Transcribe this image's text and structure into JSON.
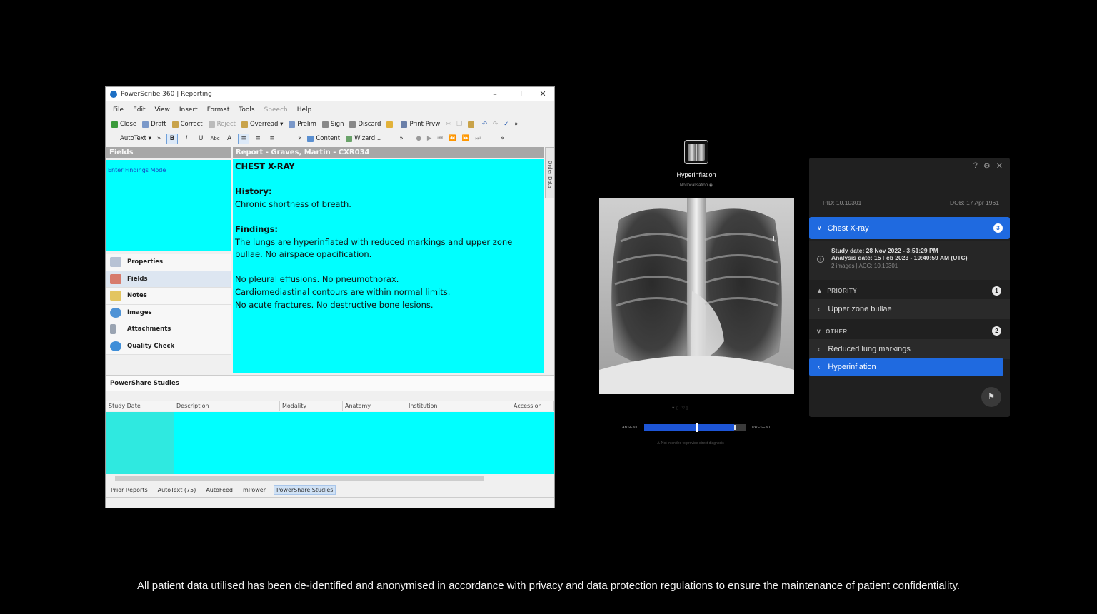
{
  "powerscribe": {
    "window_title": "PowerScribe 360 | Reporting",
    "menu": [
      {
        "label": "File"
      },
      {
        "label": "Edit"
      },
      {
        "label": "View"
      },
      {
        "label": "Insert"
      },
      {
        "label": "Format"
      },
      {
        "label": "Tools"
      },
      {
        "label": "Speech"
      },
      {
        "label": "Help"
      }
    ],
    "toolbar1": {
      "close": "Close",
      "draft": "Draft",
      "correct": "Correct",
      "reject": "Reject",
      "overread": "Overread",
      "prelim": "Prelim",
      "sign": "Sign",
      "discard": "Discard",
      "print_preview": "Print Prvw"
    },
    "toolbar2": {
      "autotext": "AutoText",
      "bold": "B",
      "italic": "I",
      "underline": "U",
      "content": "Content",
      "wizard": "Wizard..."
    },
    "fields_header": "Fields",
    "enter_findings_mode": "Enter Findings Mode",
    "report_header": "Report - Graves, Martin - CXR034",
    "side_tab": "Order Data",
    "report": {
      "title": "CHEST X-RAY",
      "history_label": "History:",
      "history_text": "Chronic shortness of breath.",
      "findings_label": "Findings:",
      "findings_line1": "The lungs are hyperinflated with reduced markings and upper zone",
      "findings_line2": "bullae. No airspace opacification.",
      "line3": "No pleural effusions. No pneumothorax.",
      "line4": "Cardiomediastinal contours are within normal limits.",
      "line5": "No acute fractures. No destructive bone lesions."
    },
    "nav_items": [
      {
        "label": "Properties"
      },
      {
        "label": "Fields"
      },
      {
        "label": "Notes"
      },
      {
        "label": "Images"
      },
      {
        "label": "Attachments"
      },
      {
        "label": "Quality Check"
      }
    ],
    "powershare_header": "PowerShare Studies",
    "grid_columns": [
      "Study Date",
      "Description",
      "Modality",
      "Anatomy",
      "Institution",
      "Accession"
    ],
    "bottom_tabs": [
      "Prior Reports",
      "AutoText (75)",
      "AutoFeed",
      "mPower",
      "PowerShare Studies"
    ]
  },
  "xray_viewer": {
    "finding_title": "Hyperinflation",
    "localisation": "No localisation",
    "absent_label": "ABSENT",
    "present_label": "PRESENT",
    "score": 0.51,
    "threshold": 0.88,
    "disclaimer_small": "Not intended to provide direct diagnosis"
  },
  "panel": {
    "pid": "PID: 10.10301",
    "dob": "DOB: 17 Apr 1961",
    "study_title": "Chest X-ray",
    "study_count": "3",
    "study_date": "Study date:  28 Nov 2022 - 3:51:29 PM",
    "analysis_date": "Analysis date:  15 Feb 2023 - 10:40:59 AM (UTC)",
    "images_acc": "2 images | ACC: 10.10301",
    "priority_label": "PRIORITY",
    "priority_count": "1",
    "priority_findings": [
      "Upper zone bullae"
    ],
    "other_label": "OTHER",
    "other_count": "2",
    "other_findings": [
      "Reduced lung markings",
      "Hyperinflation"
    ]
  },
  "colors": {
    "accent_blue": "#1f6ae0",
    "report_bg": "#00ffff"
  },
  "footer_disclaimer": "All patient data utilised has been de-identified and anonymised in accordance with privacy and data protection regulations to ensure the maintenance of patient confidentiality."
}
